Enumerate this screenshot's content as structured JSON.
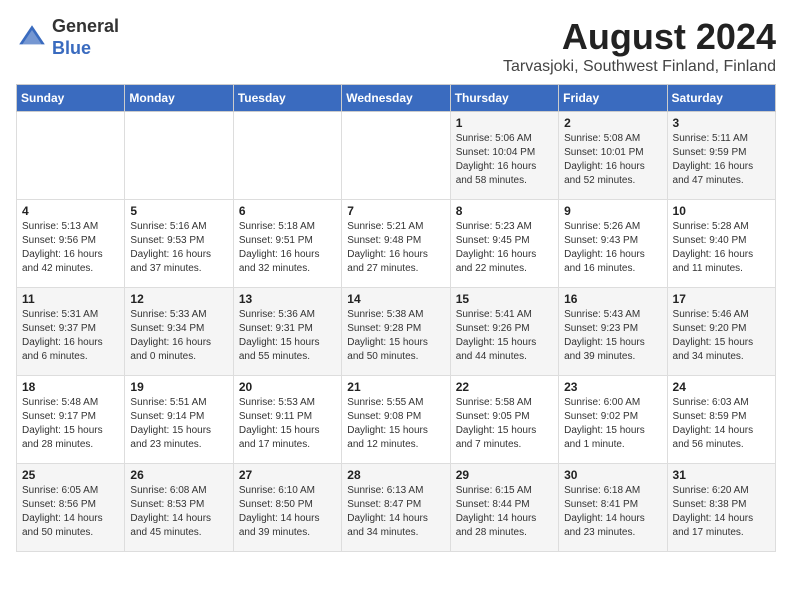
{
  "logo": {
    "general": "General",
    "blue": "Blue"
  },
  "title": {
    "month_year": "August 2024",
    "location": "Tarvasjoki, Southwest Finland, Finland"
  },
  "days_of_week": [
    "Sunday",
    "Monday",
    "Tuesday",
    "Wednesday",
    "Thursday",
    "Friday",
    "Saturday"
  ],
  "weeks": [
    [
      {
        "day": "",
        "content": ""
      },
      {
        "day": "",
        "content": ""
      },
      {
        "day": "",
        "content": ""
      },
      {
        "day": "",
        "content": ""
      },
      {
        "day": "1",
        "content": "Sunrise: 5:06 AM\nSunset: 10:04 PM\nDaylight: 16 hours\nand 58 minutes."
      },
      {
        "day": "2",
        "content": "Sunrise: 5:08 AM\nSunset: 10:01 PM\nDaylight: 16 hours\nand 52 minutes."
      },
      {
        "day": "3",
        "content": "Sunrise: 5:11 AM\nSunset: 9:59 PM\nDaylight: 16 hours\nand 47 minutes."
      }
    ],
    [
      {
        "day": "4",
        "content": "Sunrise: 5:13 AM\nSunset: 9:56 PM\nDaylight: 16 hours\nand 42 minutes."
      },
      {
        "day": "5",
        "content": "Sunrise: 5:16 AM\nSunset: 9:53 PM\nDaylight: 16 hours\nand 37 minutes."
      },
      {
        "day": "6",
        "content": "Sunrise: 5:18 AM\nSunset: 9:51 PM\nDaylight: 16 hours\nand 32 minutes."
      },
      {
        "day": "7",
        "content": "Sunrise: 5:21 AM\nSunset: 9:48 PM\nDaylight: 16 hours\nand 27 minutes."
      },
      {
        "day": "8",
        "content": "Sunrise: 5:23 AM\nSunset: 9:45 PM\nDaylight: 16 hours\nand 22 minutes."
      },
      {
        "day": "9",
        "content": "Sunrise: 5:26 AM\nSunset: 9:43 PM\nDaylight: 16 hours\nand 16 minutes."
      },
      {
        "day": "10",
        "content": "Sunrise: 5:28 AM\nSunset: 9:40 PM\nDaylight: 16 hours\nand 11 minutes."
      }
    ],
    [
      {
        "day": "11",
        "content": "Sunrise: 5:31 AM\nSunset: 9:37 PM\nDaylight: 16 hours\nand 6 minutes."
      },
      {
        "day": "12",
        "content": "Sunrise: 5:33 AM\nSunset: 9:34 PM\nDaylight: 16 hours\nand 0 minutes."
      },
      {
        "day": "13",
        "content": "Sunrise: 5:36 AM\nSunset: 9:31 PM\nDaylight: 15 hours\nand 55 minutes."
      },
      {
        "day": "14",
        "content": "Sunrise: 5:38 AM\nSunset: 9:28 PM\nDaylight: 15 hours\nand 50 minutes."
      },
      {
        "day": "15",
        "content": "Sunrise: 5:41 AM\nSunset: 9:26 PM\nDaylight: 15 hours\nand 44 minutes."
      },
      {
        "day": "16",
        "content": "Sunrise: 5:43 AM\nSunset: 9:23 PM\nDaylight: 15 hours\nand 39 minutes."
      },
      {
        "day": "17",
        "content": "Sunrise: 5:46 AM\nSunset: 9:20 PM\nDaylight: 15 hours\nand 34 minutes."
      }
    ],
    [
      {
        "day": "18",
        "content": "Sunrise: 5:48 AM\nSunset: 9:17 PM\nDaylight: 15 hours\nand 28 minutes."
      },
      {
        "day": "19",
        "content": "Sunrise: 5:51 AM\nSunset: 9:14 PM\nDaylight: 15 hours\nand 23 minutes."
      },
      {
        "day": "20",
        "content": "Sunrise: 5:53 AM\nSunset: 9:11 PM\nDaylight: 15 hours\nand 17 minutes."
      },
      {
        "day": "21",
        "content": "Sunrise: 5:55 AM\nSunset: 9:08 PM\nDaylight: 15 hours\nand 12 minutes."
      },
      {
        "day": "22",
        "content": "Sunrise: 5:58 AM\nSunset: 9:05 PM\nDaylight: 15 hours\nand 7 minutes."
      },
      {
        "day": "23",
        "content": "Sunrise: 6:00 AM\nSunset: 9:02 PM\nDaylight: 15 hours\nand 1 minute."
      },
      {
        "day": "24",
        "content": "Sunrise: 6:03 AM\nSunset: 8:59 PM\nDaylight: 14 hours\nand 56 minutes."
      }
    ],
    [
      {
        "day": "25",
        "content": "Sunrise: 6:05 AM\nSunset: 8:56 PM\nDaylight: 14 hours\nand 50 minutes."
      },
      {
        "day": "26",
        "content": "Sunrise: 6:08 AM\nSunset: 8:53 PM\nDaylight: 14 hours\nand 45 minutes."
      },
      {
        "day": "27",
        "content": "Sunrise: 6:10 AM\nSunset: 8:50 PM\nDaylight: 14 hours\nand 39 minutes."
      },
      {
        "day": "28",
        "content": "Sunrise: 6:13 AM\nSunset: 8:47 PM\nDaylight: 14 hours\nand 34 minutes."
      },
      {
        "day": "29",
        "content": "Sunrise: 6:15 AM\nSunset: 8:44 PM\nDaylight: 14 hours\nand 28 minutes."
      },
      {
        "day": "30",
        "content": "Sunrise: 6:18 AM\nSunset: 8:41 PM\nDaylight: 14 hours\nand 23 minutes."
      },
      {
        "day": "31",
        "content": "Sunrise: 6:20 AM\nSunset: 8:38 PM\nDaylight: 14 hours\nand 17 minutes."
      }
    ]
  ]
}
